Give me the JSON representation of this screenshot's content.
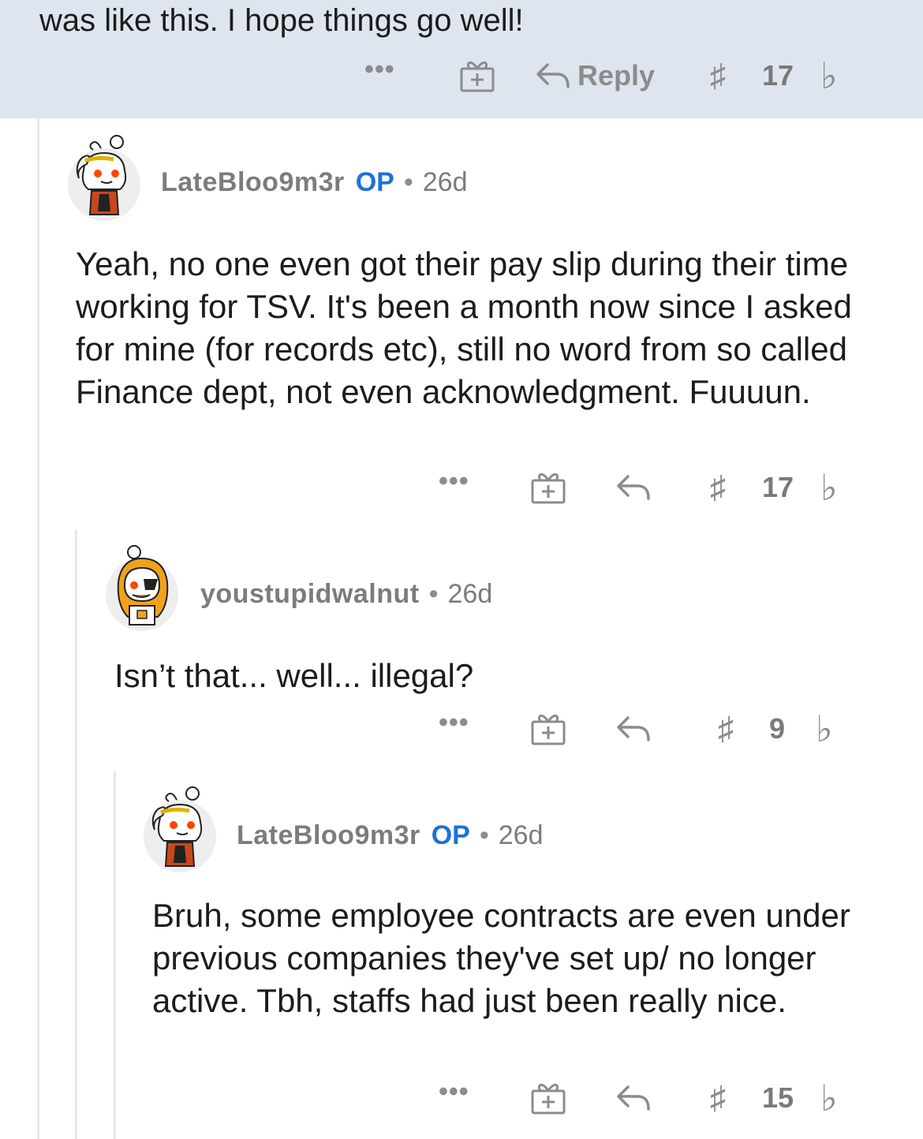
{
  "parent_comment": {
    "tail_text": "was like this. I hope things go well!",
    "actions": {
      "more": "•••",
      "reply_label": "Reply",
      "vote_count": "17",
      "upvote_glyph": "♯",
      "downvote_glyph": "♭"
    }
  },
  "comments": [
    {
      "username": "LateBloo9m3r",
      "op_label": "OP",
      "separator": "•",
      "age": "26d",
      "body": "Yeah, no one even got their pay slip during their time working for TSV. It's been a month now since I asked for mine (for records etc), still no word from so called Finance dept, not even acknowledgment. Fuuuun.",
      "actions": {
        "more": "•••",
        "vote_count": "17",
        "upvote_glyph": "♯",
        "downvote_glyph": "♭"
      }
    },
    {
      "username": "youstupidwalnut",
      "separator": "•",
      "age": "26d",
      "body": "Isn’t that... well... illegal?",
      "actions": {
        "more": "•••",
        "vote_count": "9",
        "upvote_glyph": "♯",
        "downvote_glyph": "♭"
      }
    },
    {
      "username": "LateBloo9m3r",
      "op_label": "OP",
      "separator": "•",
      "age": "26d",
      "body": "Bruh, some employee contracts are even under previous companies they've set up/ no longer active. Tbh, staffs had just been really nice.",
      "actions": {
        "more": "•••",
        "vote_count": "15",
        "upvote_glyph": "♯",
        "downvote_glyph": "♭"
      }
    }
  ],
  "colors": {
    "highlight_bg": "#dfe5ee",
    "op_blue": "#1d72d6",
    "meta_gray": "#7c7c7c",
    "thread_line": "#e6e6e6"
  },
  "icons": [
    "more-icon",
    "award-icon",
    "reply-icon",
    "upvote-icon",
    "downvote-icon",
    "avatar"
  ]
}
